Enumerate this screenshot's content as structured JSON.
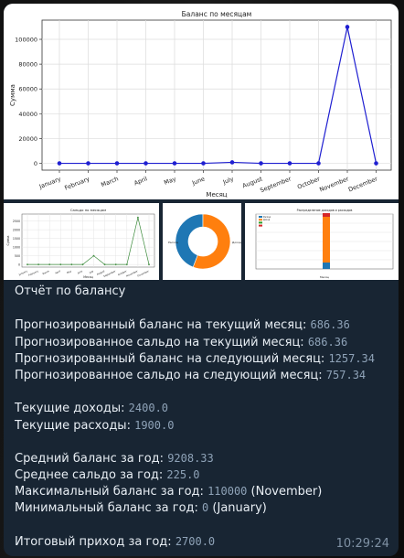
{
  "main_chart": {
    "type": "line",
    "title": "Баланс по месяцам",
    "xlabel": "Месяц",
    "ylabel": "Сумма",
    "categories": [
      "January",
      "February",
      "March",
      "April",
      "May",
      "June",
      "July",
      "August",
      "September",
      "October",
      "November",
      "December"
    ],
    "series": [
      {
        "values": [
          0,
          0,
          0,
          0,
          0,
          0,
          800,
          0,
          0,
          0,
          110000,
          0
        ]
      }
    ],
    "yticks": [
      0,
      20000,
      40000,
      60000,
      80000,
      100000
    ],
    "ylim": [
      -5500,
      115500
    ],
    "grid": true,
    "color": "#1f1fd1"
  },
  "chart_data": [
    {
      "type": "line",
      "title": "Баланс по месяцам",
      "xlabel": "Месяц",
      "ylabel": "Сумма",
      "categories": [
        "January",
        "February",
        "March",
        "April",
        "May",
        "June",
        "July",
        "August",
        "September",
        "October",
        "November",
        "December"
      ],
      "values": [
        0,
        0,
        0,
        0,
        0,
        0,
        800,
        0,
        0,
        0,
        110000,
        0
      ],
      "ylim": [
        -5500,
        115500
      ]
    },
    {
      "type": "line",
      "title": "Сальдо по месяцам",
      "categories": [
        "January",
        "February",
        "March",
        "April",
        "May",
        "June",
        "July",
        "August",
        "September",
        "October",
        "November",
        "December"
      ],
      "values": [
        0,
        0,
        0,
        0,
        0,
        0,
        500,
        0,
        0,
        0,
        2700,
        0
      ],
      "ylim": [
        -150,
        2900
      ]
    },
    {
      "type": "pie",
      "labels": [
        "Расход",
        "Доход"
      ],
      "values": [
        1900,
        2400
      ],
      "colors": [
        "#1f77b4",
        "#ff7f0e"
      ]
    },
    {
      "type": "bar",
      "title": "Распределение доходов и расходов",
      "series": [
        {
          "name": "Расход",
          "color": "#1f77b4"
        },
        {
          "name": "Доход",
          "color": "#ff7f0e"
        },
        {
          "color": "#2ca02c"
        },
        {
          "color": "#d62728"
        }
      ]
    }
  ],
  "small_line": {
    "title": "Сальдо по месяцам",
    "ylabel": "Сумма",
    "xlabel": "Месяц",
    "months_short": [
      "January",
      "February",
      "March",
      "April",
      "May",
      "June",
      "July",
      "August",
      "September",
      "October",
      "November",
      "December"
    ],
    "values": [
      0,
      0,
      0,
      0,
      0,
      0,
      500,
      0,
      0,
      0,
      2700,
      0
    ],
    "yticks": [
      0,
      500,
      1000,
      1500,
      2000,
      2500
    ],
    "color": "#3a8a3a"
  },
  "donut": {
    "labels": [
      "Расход",
      "Доход"
    ],
    "values": [
      1900,
      2400
    ],
    "colors": [
      "#1f77b4",
      "#ff7f0e"
    ]
  },
  "small_bar": {
    "title": "Распределение доходов и расходов",
    "legend": [
      "Расход",
      "Доход",
      "",
      ""
    ],
    "colors": [
      "#1f77b4",
      "#ff7f0e",
      "#2ca02c",
      "#d62728"
    ],
    "xlabel": "Месяц"
  },
  "message": {
    "title": "Отчёт по балансу",
    "forecast": [
      {
        "label": "Прогнозированный баланс на текущий месяц: ",
        "value": "686.36"
      },
      {
        "label": "Прогнозированное сальдо на текущий месяц: ",
        "value": "686.36"
      },
      {
        "label": "Прогнозированный баланс на следующий месяц: ",
        "value": "1257.34"
      },
      {
        "label": "Прогнозированное сальдо на следующий месяц: ",
        "value": "757.34"
      }
    ],
    "current": [
      {
        "label": "Текущие доходы: ",
        "value": "2400.0"
      },
      {
        "label": "Текущие расходы: ",
        "value": "1900.0"
      }
    ],
    "year": [
      {
        "label": "Средний баланс за год: ",
        "value": "9208.33",
        "suffix": ""
      },
      {
        "label": "Среднее сальдо за год: ",
        "value": "225.0",
        "suffix": ""
      },
      {
        "label": "Максимальный баланс за год: ",
        "value": "110000",
        "suffix": " (November)"
      },
      {
        "label": "Минимальный баланс за год: ",
        "value": "0",
        "suffix": " (January)"
      }
    ],
    "total": {
      "label": "Итоговый приход за год: ",
      "value": "2700.0"
    },
    "time": "10:29:24"
  }
}
